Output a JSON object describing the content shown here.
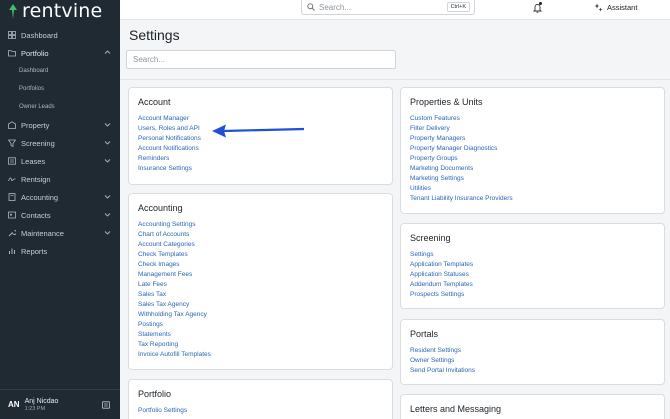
{
  "brand": {
    "name": "rentvine"
  },
  "sidebar": {
    "items": [
      {
        "label": "Dashboard",
        "icon": "dashboard-icon"
      },
      {
        "label": "Portfolio",
        "icon": "folder-icon",
        "expanded": true,
        "children": [
          {
            "label": "Dashboard"
          },
          {
            "label": "Portfolios"
          },
          {
            "label": "Owner Leads"
          }
        ]
      },
      {
        "label": "Property",
        "icon": "building-icon"
      },
      {
        "label": "Screening",
        "icon": "funnel-icon"
      },
      {
        "label": "Leases",
        "icon": "lease-icon"
      },
      {
        "label": "Rentsign",
        "icon": "signature-icon"
      },
      {
        "label": "Accounting",
        "icon": "accounting-icon"
      },
      {
        "label": "Contacts",
        "icon": "contacts-icon"
      },
      {
        "label": "Maintenance",
        "icon": "wrench-icon"
      },
      {
        "label": "Reports",
        "icon": "reports-icon"
      }
    ],
    "user": {
      "initials": "AN",
      "name": "Anj Nicdao",
      "time": "1:23 PM"
    }
  },
  "topbar": {
    "search_placeholder": "Search...",
    "shortcut": "Ctrl+K",
    "assistant_label": "Assistant"
  },
  "page": {
    "title": "Settings",
    "search_placeholder": "Search..."
  },
  "cards": {
    "account": {
      "title": "Account",
      "links": [
        "Account Manager",
        "Users, Roles and API",
        "Personal Notifications",
        "Account Notifications",
        "Reminders",
        "Insurance Settings"
      ]
    },
    "accounting": {
      "title": "Accounting",
      "links": [
        "Accounting Settings",
        "Chart of Accounts",
        "Account Categories",
        "Check Templates",
        "Check Images",
        "Management Fees",
        "Late Fees",
        "Sales Tax",
        "Sales Tax Agency",
        "Withholding Tax Agency",
        "Postings",
        "Statements",
        "Tax Reporting",
        "Invoice Autofill Templates"
      ]
    },
    "portfolio": {
      "title": "Portfolio",
      "links": [
        "Portfolio Settings"
      ]
    },
    "properties": {
      "title": "Properties & Units",
      "links": [
        "Custom Features",
        "Filter Delivery",
        "Property Managers",
        "Property Manager Diagnostics",
        "Property Groups",
        "Marketing Documents",
        "Marketing Settings",
        "Utilities",
        "Tenant Liability Insurance Providers"
      ]
    },
    "screening": {
      "title": "Screening",
      "links": [
        "Settings",
        "Application Templates",
        "Application Statuses",
        "Addendum Templates",
        "Prospects Settings"
      ]
    },
    "portals": {
      "title": "Portals",
      "links": [
        "Resident Settings",
        "Owner Settings",
        "Send Portal Invitations"
      ]
    },
    "letters": {
      "title": "Letters and Messaging",
      "links": []
    }
  },
  "colors": {
    "sidebar_bg": "#202a33",
    "link": "#2a66b3",
    "brand_green": "#3fbf6a",
    "arrow": "#1f4fd6"
  }
}
